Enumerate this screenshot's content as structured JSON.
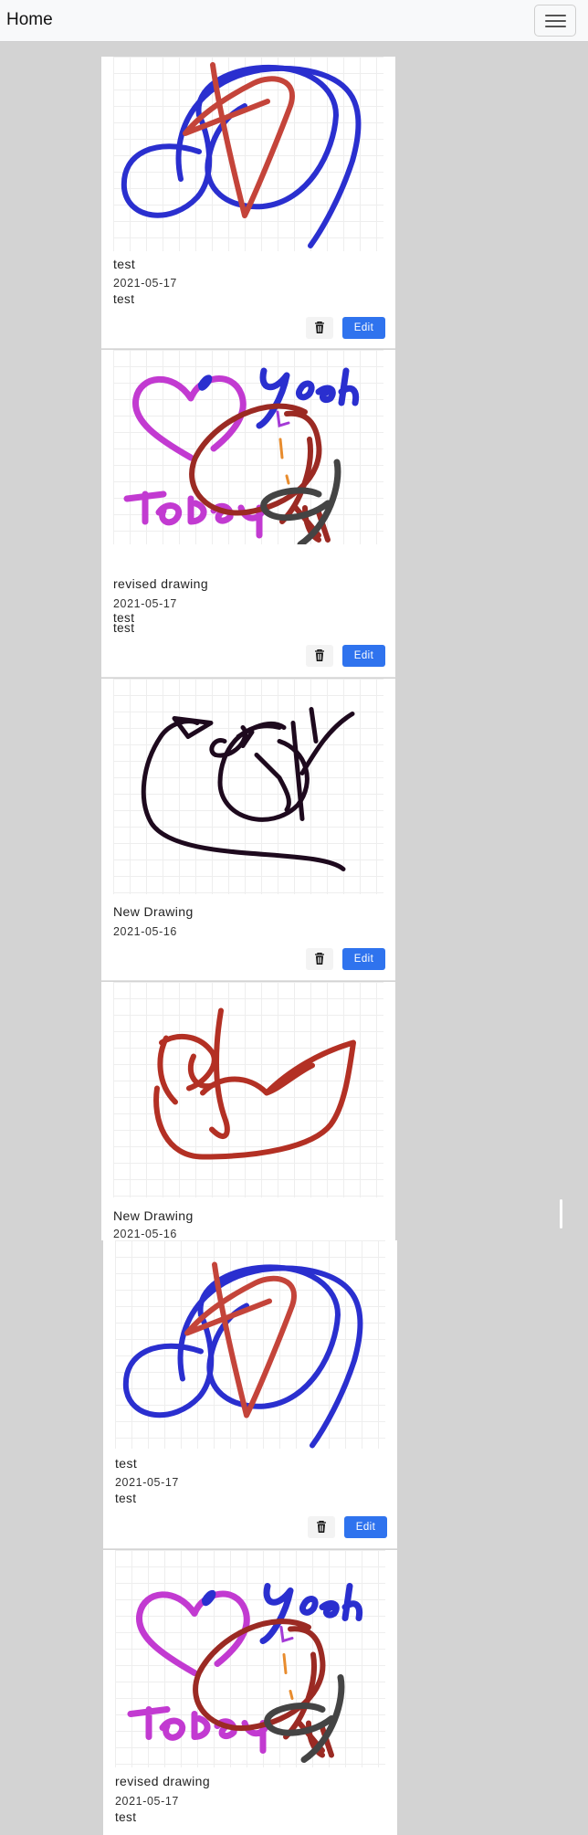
{
  "navbar": {
    "brand": "Home",
    "menu_icon": "hamburger-icon"
  },
  "cards": [
    {
      "title": "test",
      "date": "2021-05-17",
      "description": "test",
      "drawing": "circles-and-cross",
      "delete_icon": "trash-icon",
      "edit_label": "Edit"
    },
    {
      "title": "revised drawing",
      "date": "2021-05-17",
      "description": "test",
      "description_echo": "test",
      "drawing": "heart-today-yeah",
      "delete_icon": "trash-icon",
      "edit_label": "Edit"
    },
    {
      "title": "New Drawing",
      "date": "2021-05-16",
      "drawing": "test-scribble",
      "delete_icon": "trash-icon",
      "edit_label": "Edit"
    },
    {
      "title": "New Drawing",
      "date": "2021-05-16",
      "drawing": "red-fish"
    },
    {
      "title": "test",
      "date": "2021-05-17",
      "description": "test",
      "drawing": "circles-and-cross",
      "delete_icon": "trash-icon",
      "edit_label": "Edit"
    },
    {
      "title": "revised drawing",
      "date": "2021-05-17",
      "description": "test",
      "drawing": "heart-today-yeah"
    }
  ],
  "colors": {
    "edit_button": "#2f73ee",
    "background": "#d3d3d3",
    "ink_blue": "#2a2fcf",
    "ink_red": "#c4443a",
    "ink_magenta": "#c23ad1",
    "ink_dark": "#1e0a1e"
  }
}
